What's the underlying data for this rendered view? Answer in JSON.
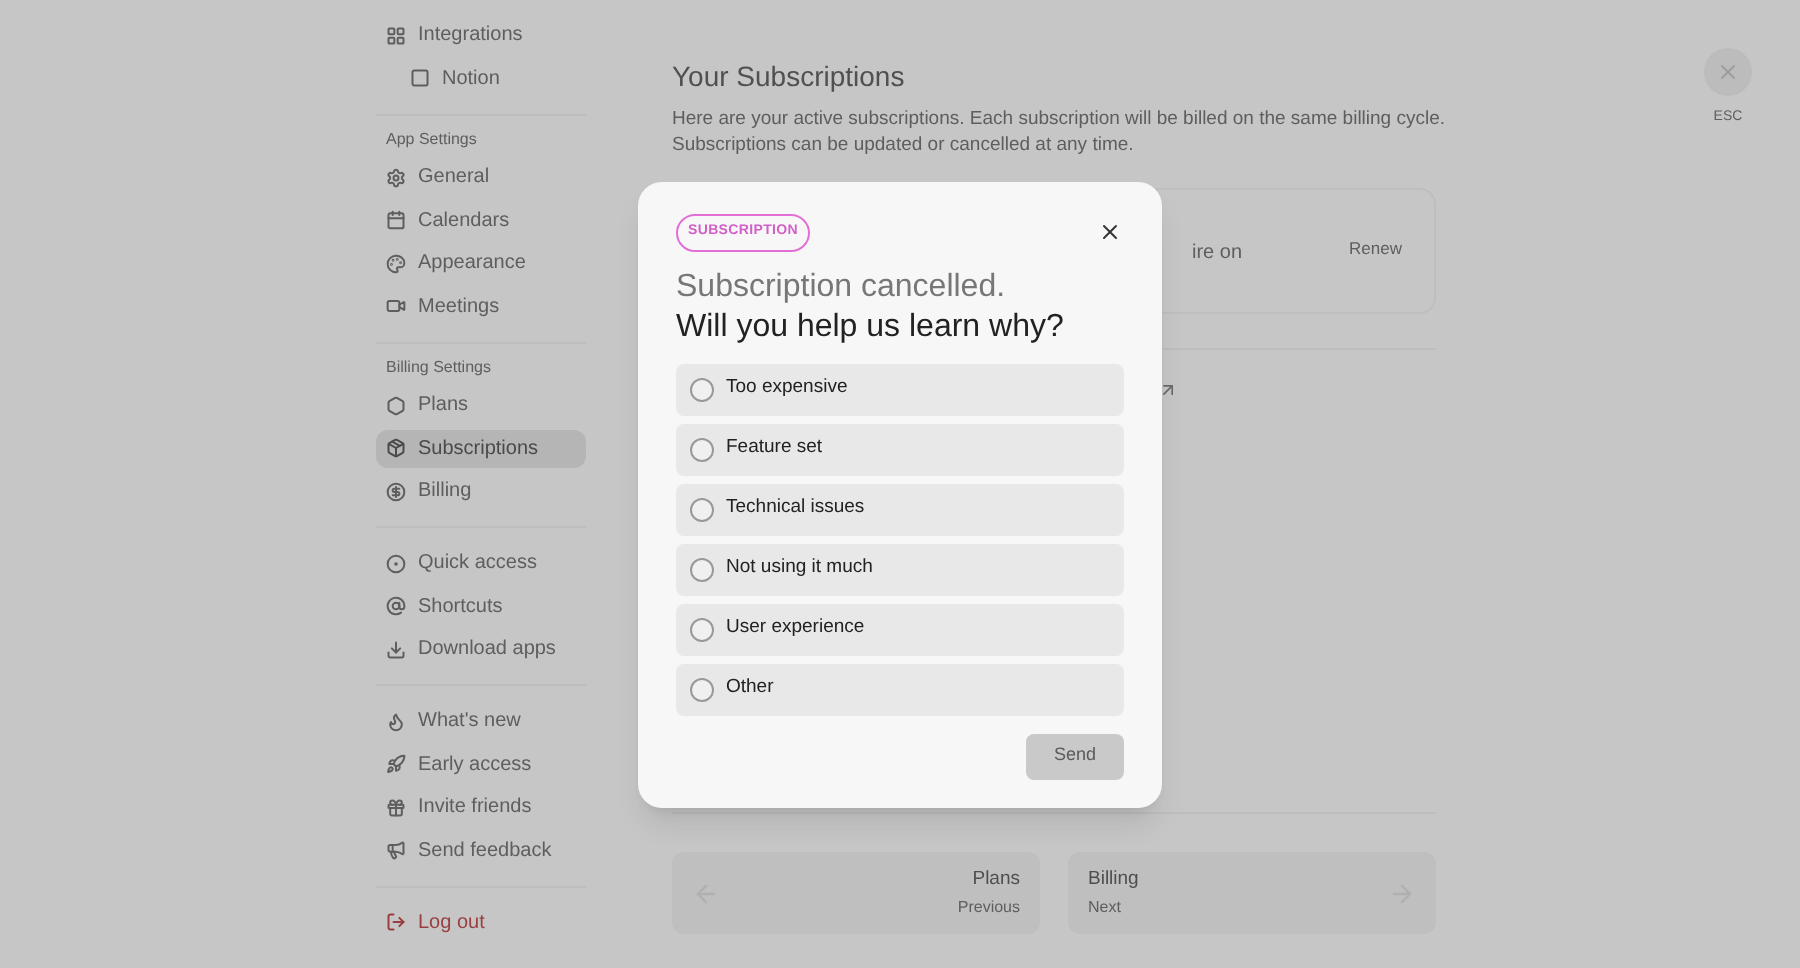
{
  "sidebar": {
    "sections": [
      {
        "items": [
          {
            "label": "Integrations",
            "selected": false,
            "children": [
              {
                "label": "Notion",
                "selected": false
              }
            ]
          }
        ]
      },
      {
        "heading": "App Settings",
        "items": [
          {
            "label": "General",
            "selected": false
          },
          {
            "label": "Calendars",
            "selected": false
          },
          {
            "label": "Appearance",
            "selected": false
          },
          {
            "label": "Meetings",
            "selected": false
          }
        ]
      },
      {
        "heading": "Billing Settings",
        "items": [
          {
            "label": "Plans",
            "selected": false
          },
          {
            "label": "Subscriptions",
            "selected": true
          },
          {
            "label": "Billing",
            "selected": false
          }
        ]
      },
      {
        "items": [
          {
            "label": "Quick access",
            "selected": false
          },
          {
            "label": "Shortcuts",
            "selected": false
          },
          {
            "label": "Download apps",
            "selected": false
          }
        ]
      },
      {
        "items": [
          {
            "label": "What's new",
            "selected": false
          },
          {
            "label": "Early access",
            "selected": false
          },
          {
            "label": "Invite friends",
            "selected": false
          },
          {
            "label": "Send feedback",
            "selected": false
          }
        ]
      }
    ],
    "logout": "Log out"
  },
  "main": {
    "title": "Your Subscriptions",
    "description_lines": [
      "Here are your active subscriptions. Each subscription will be billed on the same billing cycle.",
      "Subscriptions can be updated or cancelled at any time."
    ],
    "card": {
      "text": "ire on",
      "action": "Renew"
    },
    "nav": [
      {
        "title": "Plans",
        "subtitle": "Previous"
      },
      {
        "title": "Billing",
        "subtitle": "Next"
      }
    ]
  },
  "close": {
    "label": "ESC"
  },
  "modal": {
    "badge": "SUBSCRIPTION",
    "title_line_1": "Subscription cancelled.",
    "title_line_2": "Will you help us learn why?",
    "options": [
      {
        "label": "Too expensive",
        "selected": false
      },
      {
        "label": "Feature set",
        "selected": false
      },
      {
        "label": "Technical issues",
        "selected": false
      },
      {
        "label": "Not using it much",
        "selected": false
      },
      {
        "label": "User experience",
        "selected": false
      },
      {
        "label": "Other",
        "selected": false
      }
    ],
    "submit": {
      "label": "Send",
      "disabled": true
    }
  }
}
